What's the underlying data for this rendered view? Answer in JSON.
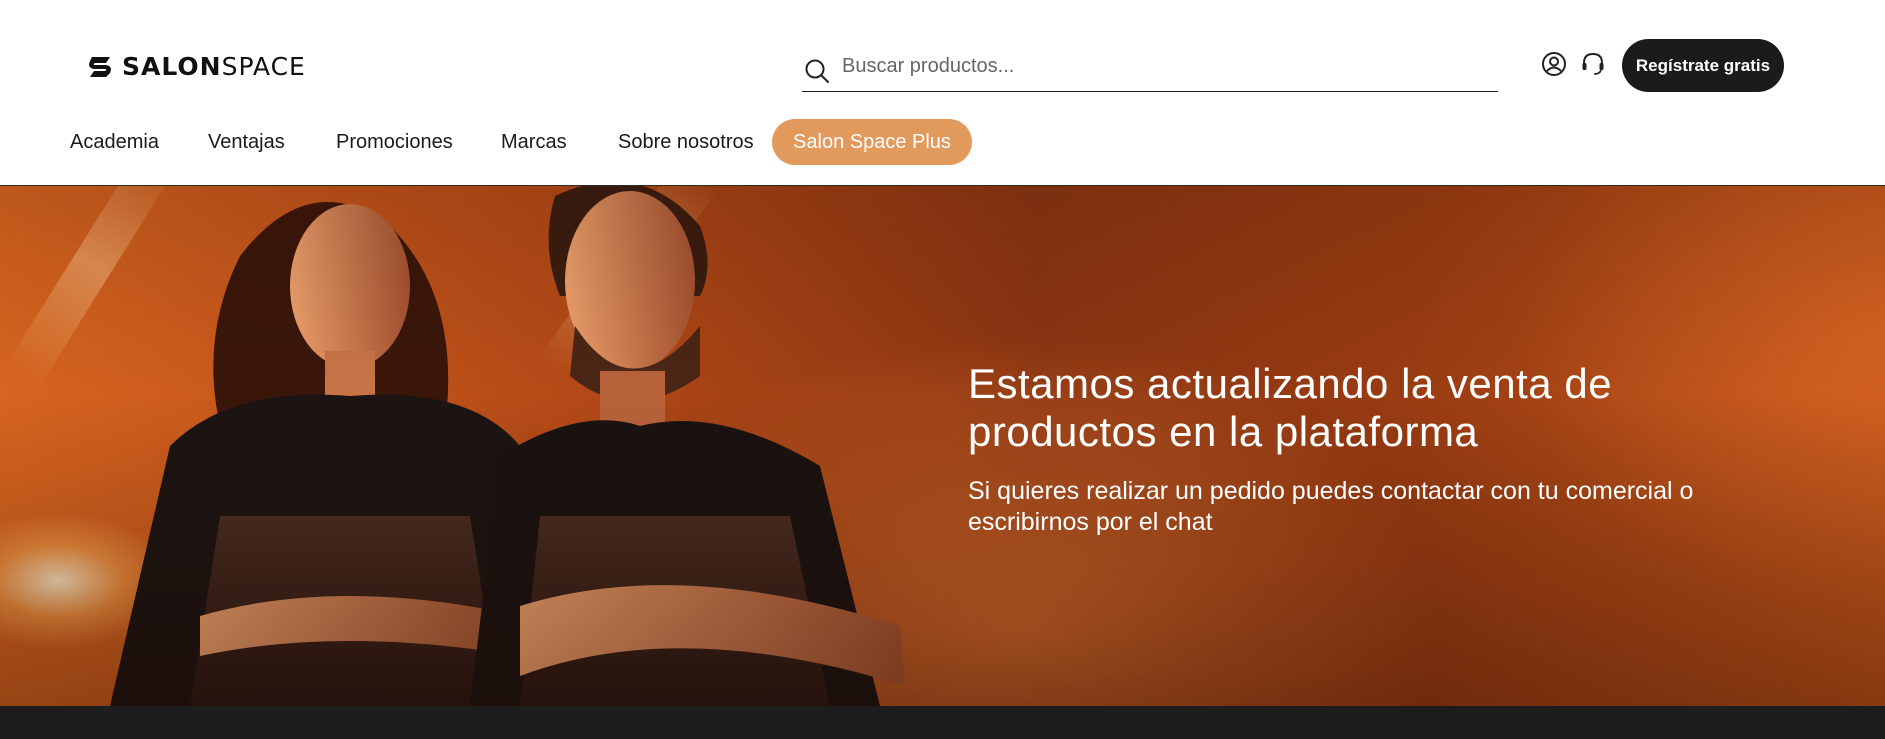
{
  "brand": {
    "logo_bold": "SALON",
    "logo_thin": "SPACE"
  },
  "search": {
    "placeholder": "Buscar productos..."
  },
  "header": {
    "register_label": "Regístrate gratis"
  },
  "nav": {
    "items": [
      {
        "label": "Academia"
      },
      {
        "label": "Ventajas"
      },
      {
        "label": "Promociones"
      },
      {
        "label": "Marcas"
      },
      {
        "label": "Sobre nosotros"
      }
    ],
    "plus_label": "Salon Space Plus"
  },
  "hero": {
    "title": "Estamos actualizando la venta de productos en la plataforma",
    "subtitle": "Si quieres realizar un pedido puedes contactar con tu comercial o escribirnos por el chat"
  },
  "colors": {
    "accent": "#e29a5c",
    "dark": "#1b1b1b"
  },
  "icons": [
    "search-icon",
    "user-icon",
    "headset-icon",
    "logo-icon"
  ]
}
